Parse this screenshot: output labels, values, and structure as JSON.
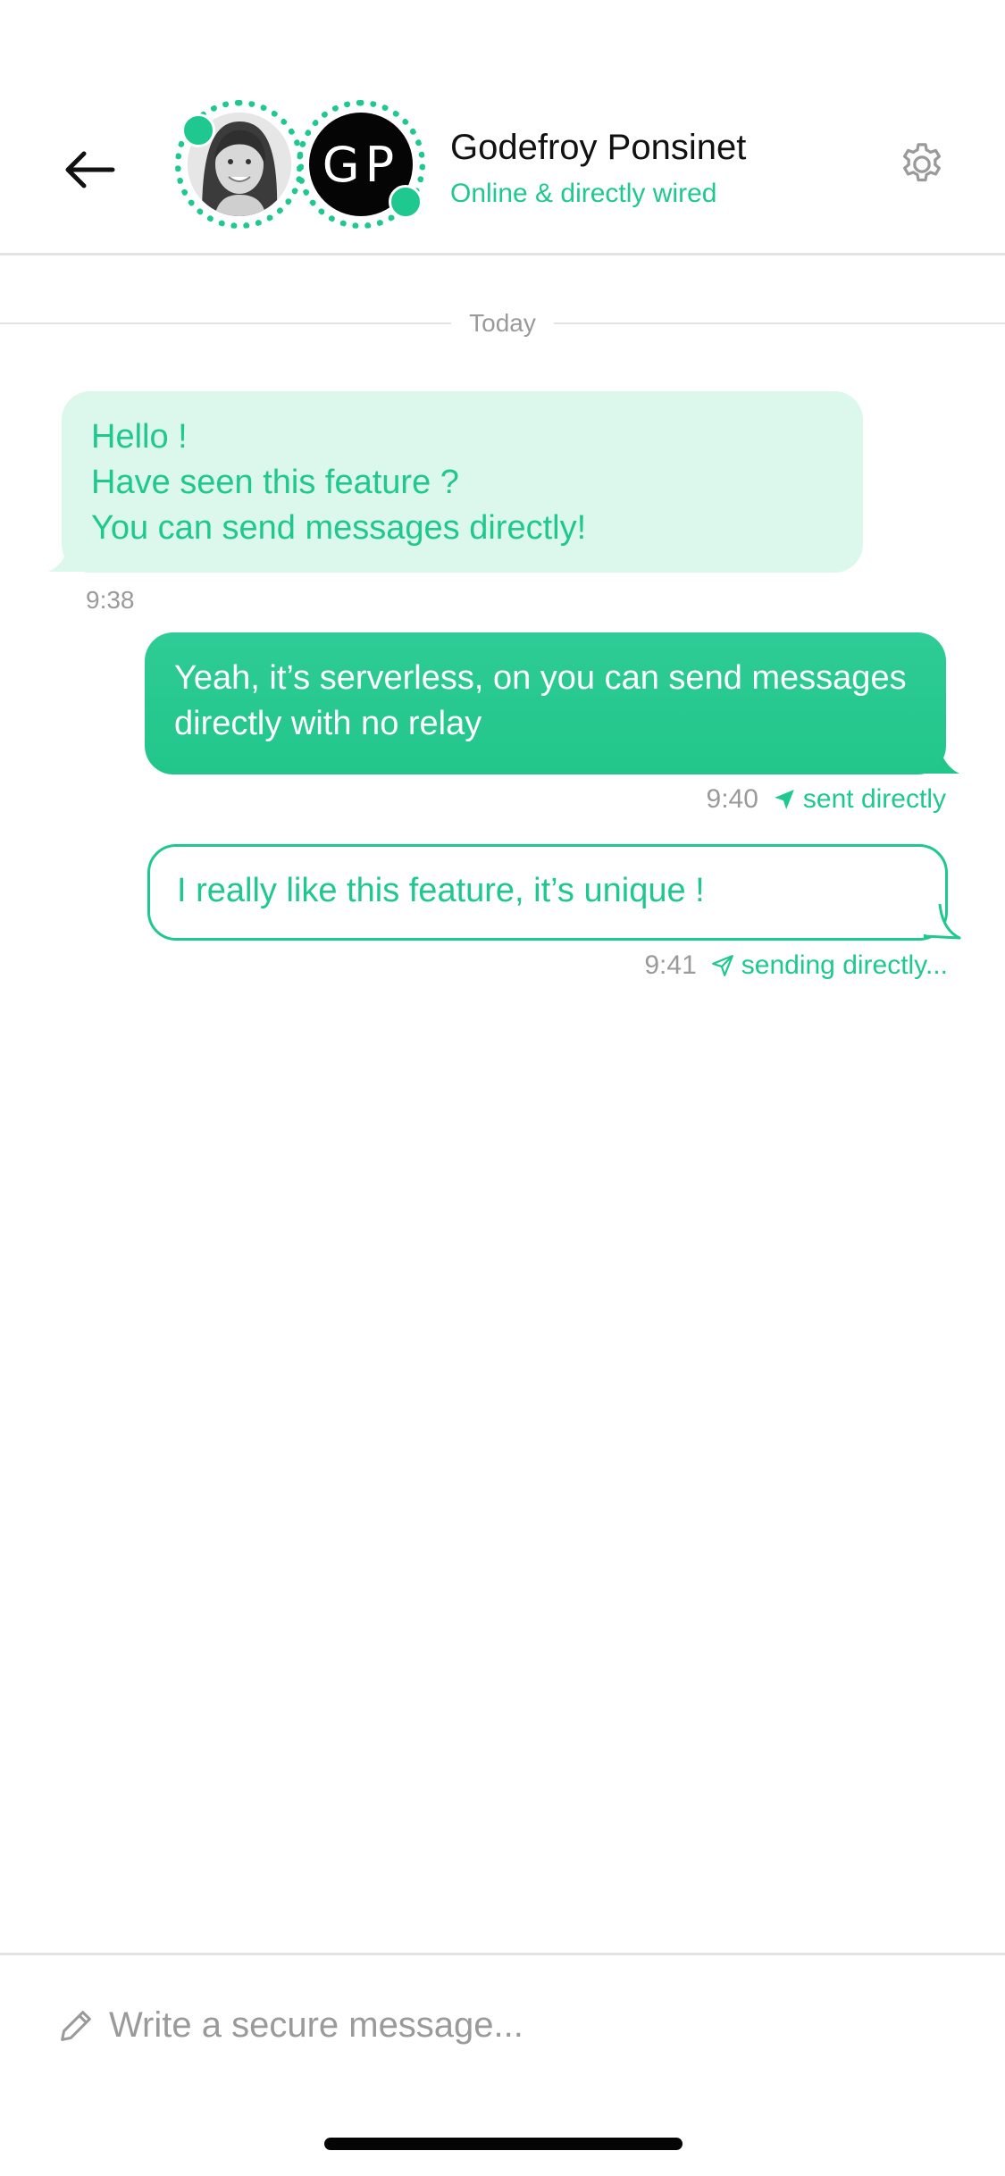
{
  "header": {
    "contact_name": "Godefroy Ponsinet",
    "contact_status": "Online & directly wired",
    "contact_initials": "GP",
    "back_icon": "arrow-left-icon",
    "settings_icon": "gear-icon",
    "photo_avatar": "contact-photo"
  },
  "conversation": {
    "date_label": "Today",
    "messages": [
      {
        "direction": "incoming",
        "lines": [
          "Hello !",
          "Have seen this feature ?",
          "You can send messages directly!"
        ],
        "time": "9:38"
      },
      {
        "direction": "outgoing",
        "text": "Yeah, it’s serverless, on you can send messages directly with no relay",
        "time": "9:40",
        "status": "sent directly",
        "status_icon": "send-filled-icon"
      },
      {
        "direction": "outgoing",
        "text": "I really like this feature, it’s unique !",
        "time": "9:41",
        "status": "sending directly...",
        "status_icon": "send-outline-icon"
      }
    ]
  },
  "composer": {
    "placeholder": "Write a secure message...",
    "value": "",
    "icon": "pencil-icon"
  },
  "colors": {
    "accent": "#1fc88e",
    "incoming_bubble": "#dcf7ec",
    "outgoing_bubble": "#2ecc96",
    "muted_text": "#9a9a9a",
    "divider": "#e3e3e3"
  }
}
